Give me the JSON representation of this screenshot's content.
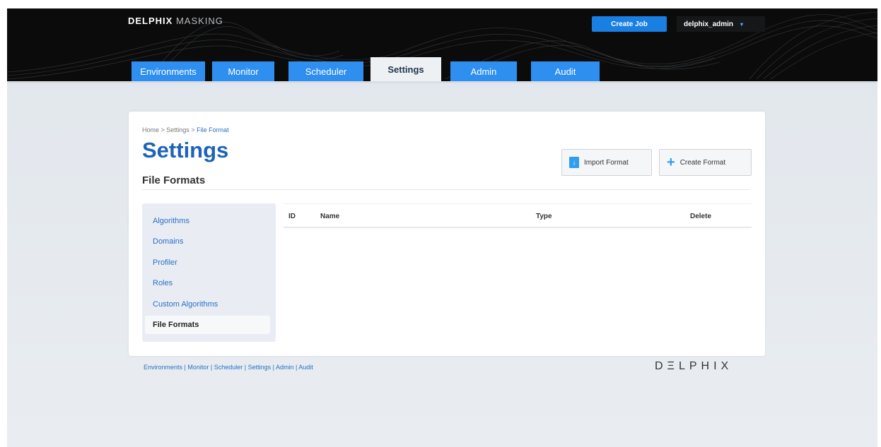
{
  "header": {
    "brand_bold": "DELPHIX",
    "brand_light": "MASKING",
    "create_job_label": "Create Job",
    "user_name": "delphix_admin",
    "user_caret": "▾",
    "tabs": [
      {
        "label": "Environments"
      },
      {
        "label": "Monitor"
      },
      {
        "label": "Scheduler"
      },
      {
        "label": "Settings",
        "active": true
      },
      {
        "label": "Admin"
      },
      {
        "label": "Audit"
      }
    ]
  },
  "breadcrumb": {
    "home": "Home",
    "sep": " > ",
    "settings": "Settings",
    "current": "File Format"
  },
  "page": {
    "title": "Settings",
    "section": "File Formats"
  },
  "actions": {
    "import_label": "Import Format",
    "create_label": "Create Format"
  },
  "side_nav": [
    {
      "label": "Algorithms"
    },
    {
      "label": "Domains"
    },
    {
      "label": "Profiler"
    },
    {
      "label": "Roles"
    },
    {
      "label": "Custom Algorithms"
    },
    {
      "label": "File Formats",
      "active": true
    }
  ],
  "table": {
    "columns": [
      "ID",
      "Name",
      "Type",
      "Delete"
    ],
    "rows": []
  },
  "footer": {
    "links": "Environments | Monitor | Scheduler | Settings | Admin | Audit",
    "logo": "DΞLPHIX"
  },
  "colors": {
    "accent": "#2f8ff0",
    "title_blue": "#1d63b9",
    "header_bg": "#0b0b0b"
  }
}
